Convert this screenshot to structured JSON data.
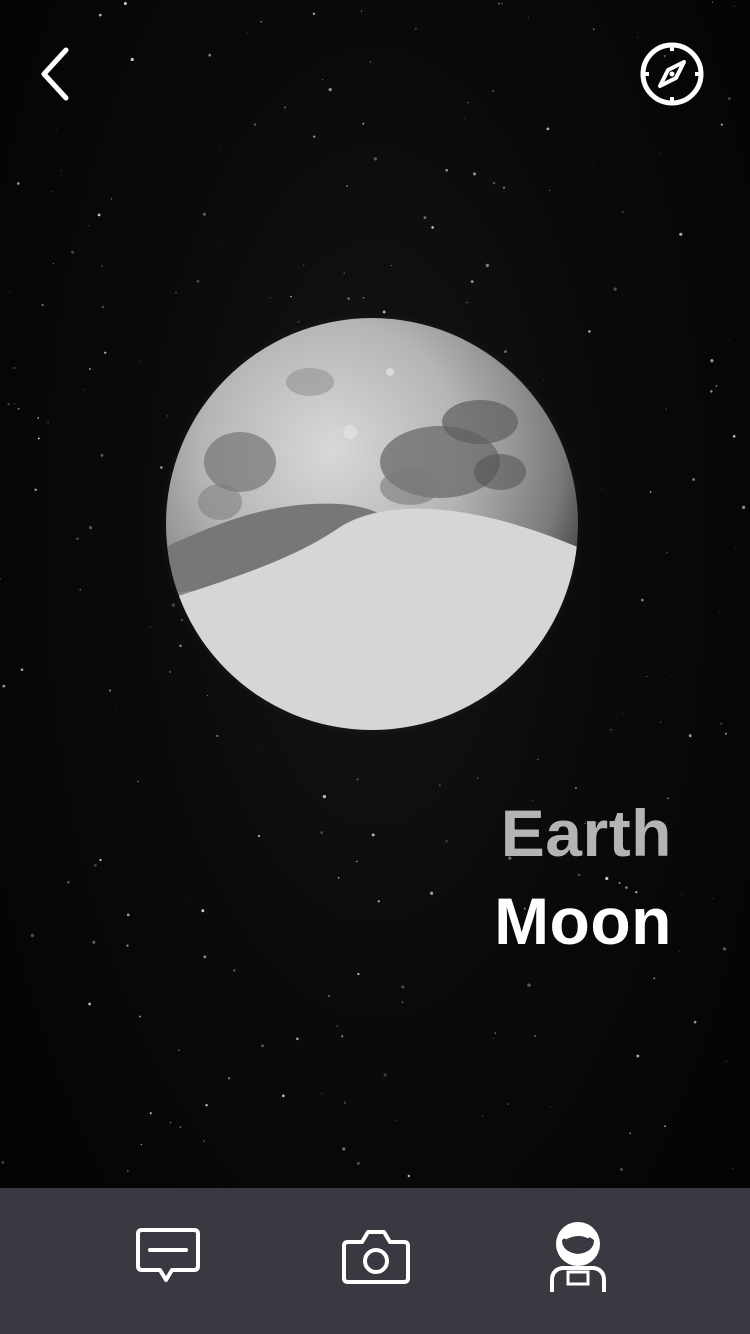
{
  "screen": {
    "background_color": "#050505",
    "tab_bar_color": "#393941"
  },
  "header": {
    "back_icon": "chevron-left-icon",
    "compass_icon": "compass-icon"
  },
  "globe": {
    "body": "moon",
    "overlay": "earth-wave"
  },
  "title": {
    "primary": "Earth",
    "secondary": "Moon",
    "primary_color": "#b4b4b4",
    "secondary_color": "#ffffff"
  },
  "tab_bar": {
    "items": [
      {
        "icon": "chat-icon"
      },
      {
        "icon": "camera-icon"
      },
      {
        "icon": "astronaut-icon"
      }
    ]
  }
}
